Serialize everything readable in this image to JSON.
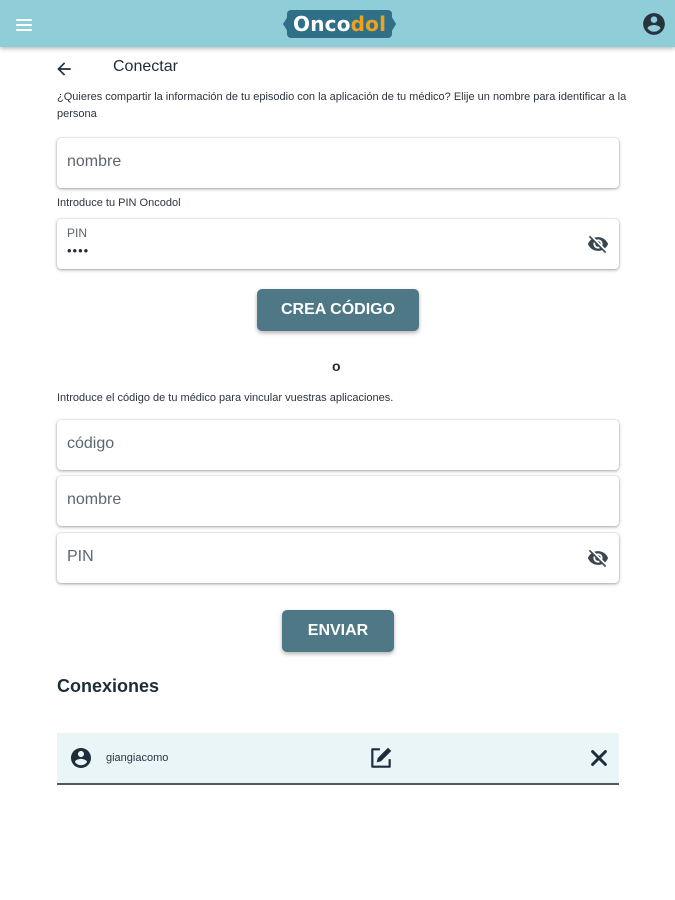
{
  "app": {
    "logo": {
      "part1": "Onco",
      "part2": "dol"
    },
    "brand_colors": {
      "header": "#8fcdd9",
      "logo_bg": "#2f7088",
      "logo_accent": "#f0a21c",
      "button": "#4f7886"
    },
    "icons": {
      "menu": "hamburger-menu-icon",
      "account": "account-circle-icon"
    }
  },
  "header": {
    "title": "Conectar",
    "back_icon": "arrow-left-icon"
  },
  "share_section": {
    "intro": "¿Quieres compartir la información de tu episodio con la aplicación de tu médico? Elije un nombre para identificar a la persona",
    "name_placeholder": "nombre",
    "pin_intro": "Introduce tu PIN Oncodol",
    "pin_label": "PIN",
    "pin_value": "••••",
    "create_button": "CREA CÓDIGO"
  },
  "or_text": "o",
  "link_section": {
    "intro": "Introduce el código de tu médico para vincular vuestras aplicaciones.",
    "code_placeholder": "código",
    "name_placeholder": "nombre",
    "pin_placeholder": "PIN",
    "send_button": "ENVIAR"
  },
  "connections": {
    "title": "Conexiones",
    "items": [
      {
        "name": "giangiacomo",
        "icons": [
          "account-circle-icon",
          "edit-icon",
          "close-icon"
        ]
      }
    ]
  }
}
